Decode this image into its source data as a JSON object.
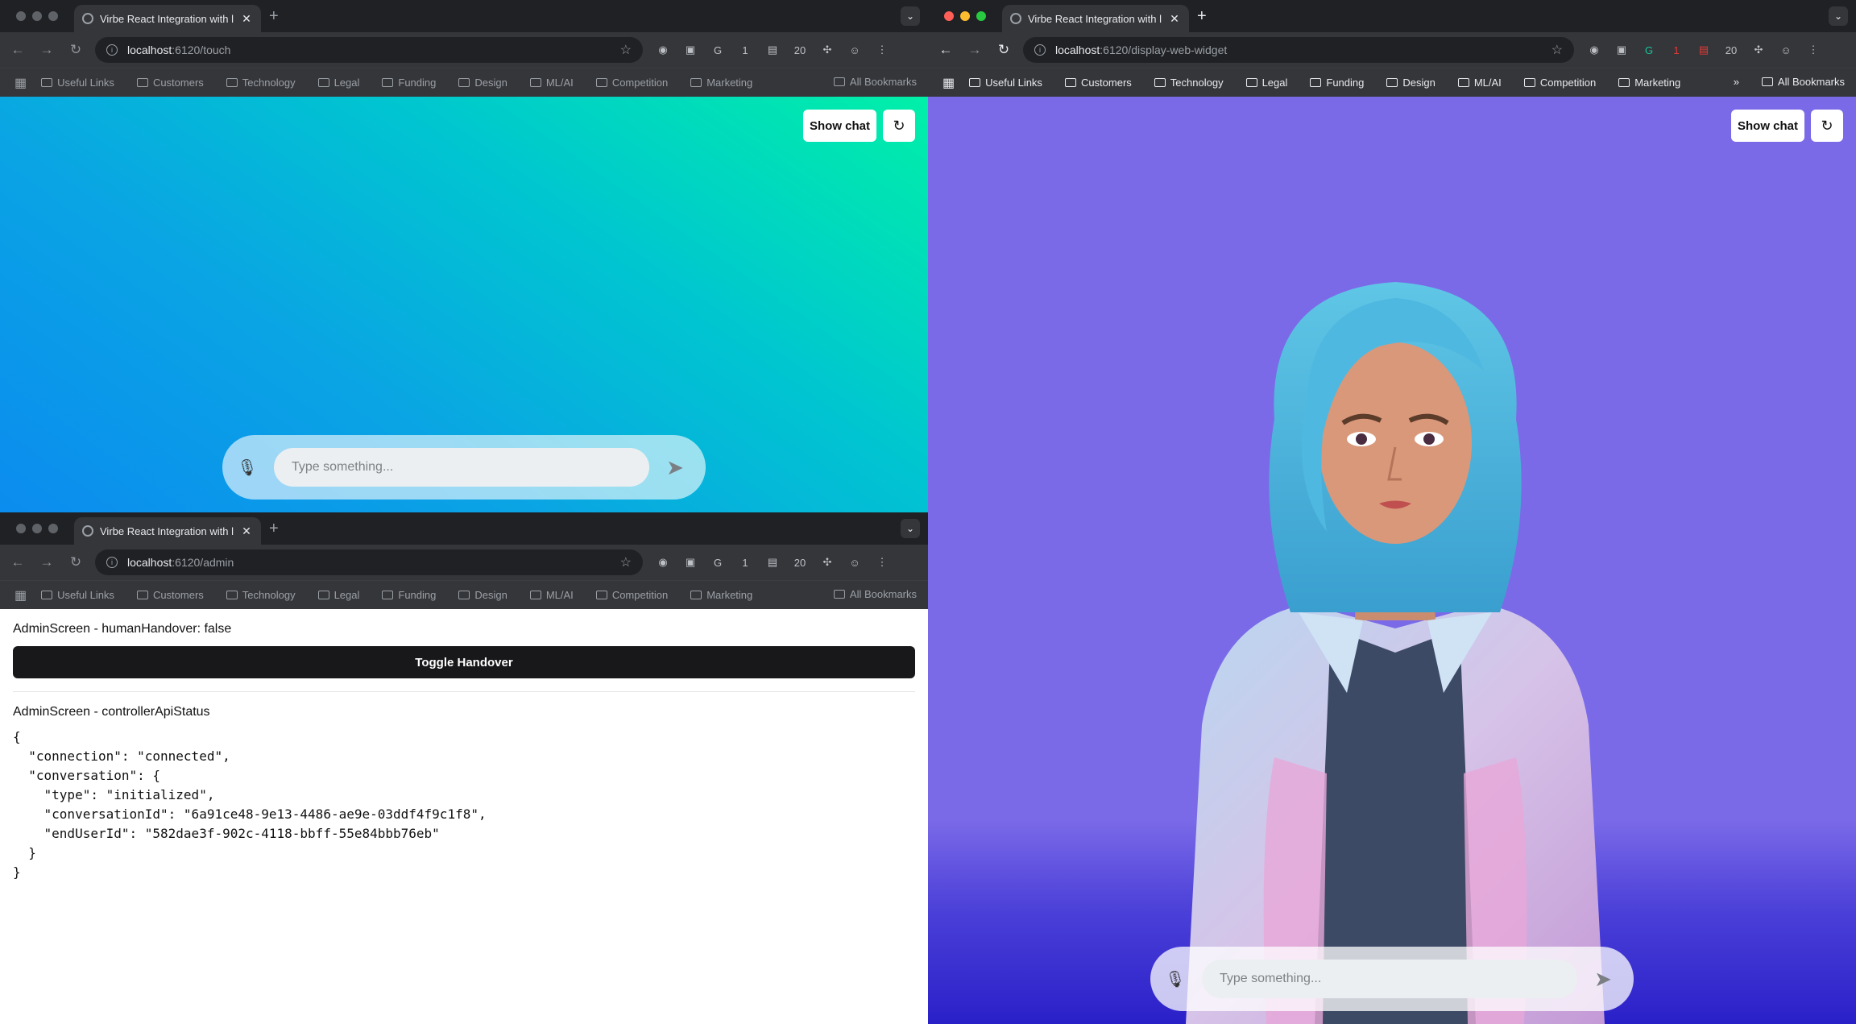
{
  "windows": {
    "touch": {
      "tab_title": "Virbe React Integration with l",
      "url_host": "localhost",
      "url_path": ":6120/touch",
      "show_chat_label": "Show chat",
      "input_placeholder": "Type something..."
    },
    "admin": {
      "tab_title": "Virbe React Integration with l",
      "url_host": "localhost",
      "url_path": ":6120/admin",
      "handover_heading": "AdminScreen - humanHandover: false",
      "toggle_label": "Toggle Handover",
      "status_heading": "AdminScreen - controllerApiStatus",
      "status_json": "{\n  \"connection\": \"connected\",\n  \"conversation\": {\n    \"type\": \"initialized\",\n    \"conversationId\": \"6a91ce48-9e13-4486-ae9e-03ddf4f9c1f8\",\n    \"endUserId\": \"582dae3f-902c-4118-bbff-55e84bbb76eb\"\n  }\n}"
    },
    "widget": {
      "tab_title": "Virbe React Integration with l",
      "url_host": "localhost",
      "url_path": ":6120/display-web-widget",
      "show_chat_label": "Show chat",
      "input_placeholder": "Type something..."
    }
  },
  "bookmarks": [
    "Useful Links",
    "Customers",
    "Technology",
    "Legal",
    "Funding",
    "Design",
    "ML/AI",
    "Competition",
    "Marketing"
  ],
  "all_bookmarks_label": "All Bookmarks",
  "extension_badge": "1",
  "extension_label_20": "20",
  "colors": {
    "touch_gradient": [
      "#00f0a8",
      "#0b8cef"
    ],
    "widget_bg": "#7b6ae8",
    "toggle_button": "#18181b"
  }
}
